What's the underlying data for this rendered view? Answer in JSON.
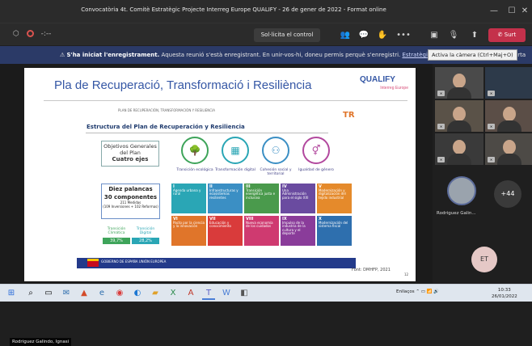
{
  "window": {
    "title": "Convocatòria 4t. Comitè Estratègic Projecte Interreg Europe QUALIFY - 26 de gener de 2022 - Format online",
    "minimize": "—",
    "maximize": "☐",
    "close": "✕"
  },
  "toolbar": {
    "timer": "-:--",
    "request_control": "Sol·licita el control",
    "leave": "Surt",
    "camera_tooltip": "Activa la càmera (Ctrl+Maj+O)"
  },
  "banner": {
    "bold": "S'ha iniciat l'enregistrament.",
    "text": "Aquesta reunió s'està enregistrant. En unir-vos-hi, doneu permís perquè s'enregistri.",
    "link": "Estratègia de privade",
    "tail": "arta"
  },
  "slide": {
    "title": "Pla de Recuperació, Transformació i Resiliència",
    "logo": "QUALIFY",
    "logo_sub": "Interreg Europe",
    "small_header": "PLAN DE RECUPERACIÓN, TRANSFORMACIÓN Y RESILIENCIA",
    "tr_logo": "TR",
    "structure_title": "Estructura del Plan de Recuperación y Resiliencia",
    "objectives_line1": "Objetivos Generales",
    "objectives_line2": "del Plan",
    "objectives_line3": "Cuatro ejes",
    "axes": [
      {
        "label": "Transición ecológica",
        "color": "#3ea45a"
      },
      {
        "label": "Transformación digital",
        "color": "#2aa6b5"
      },
      {
        "label": "Cohesión social y territorial",
        "color": "#3b8fc4"
      },
      {
        "label": "Igualdad de género",
        "color": "#b2489e"
      }
    ],
    "levers_title": "Diez palancas",
    "levers_sub": "30 componentes",
    "levers_measures": "211 Medidas",
    "levers_detail": "(109 Inversiones + 102 Reformas)",
    "transitions": [
      {
        "label": "Transición Climática",
        "pct": "39,7%",
        "color": "#3ea45a"
      },
      {
        "label": "Transición Digital",
        "pct": "28,2%",
        "color": "#2aa6b5"
      }
    ],
    "levers": [
      {
        "n": "I",
        "text": "Agenda urbana y rural",
        "color": "#2aa6b5"
      },
      {
        "n": "II",
        "text": "Infraestructuras y ecosistemas resilientes",
        "color": "#3b8fc4"
      },
      {
        "n": "III",
        "text": "Transición energética justa e inclusiva",
        "color": "#4a9a4c"
      },
      {
        "n": "IV",
        "text": "Una Administración para el siglo XXI",
        "color": "#6a4ba0"
      },
      {
        "n": "V",
        "text": "Modernización y digitalización del tejido industrial",
        "color": "#e58a2b"
      },
      {
        "n": "VI",
        "text": "Pacto por la ciencia y la innovación",
        "color": "#e0752a"
      },
      {
        "n": "VII",
        "text": "Educación y conocimiento",
        "color": "#d93b3b"
      },
      {
        "n": "VIII",
        "text": "Nueva economía de los cuidados",
        "color": "#cf3a70"
      },
      {
        "n": "IX",
        "text": "Impulso de la industria de la cultura y el deporte",
        "color": "#8a3c9a"
      },
      {
        "n": "X",
        "text": "Modernización del sistema fiscal",
        "color": "#2e6fae"
      }
    ],
    "footer_logos": "GOBIERNO DE ESPAÑA   UNIÓN EUROPEA",
    "source": "Font: DMHFP, 2021",
    "page": "12"
  },
  "presenter": "Rodriguez Galindo, Ignasi",
  "participants": {
    "avatar_name": "Rodriguez Galin...",
    "more_count": "+44",
    "self_initials": "ET"
  },
  "taskbar": {
    "lang": "Enllaços",
    "time": "10:33",
    "date": "26/01/2022"
  }
}
